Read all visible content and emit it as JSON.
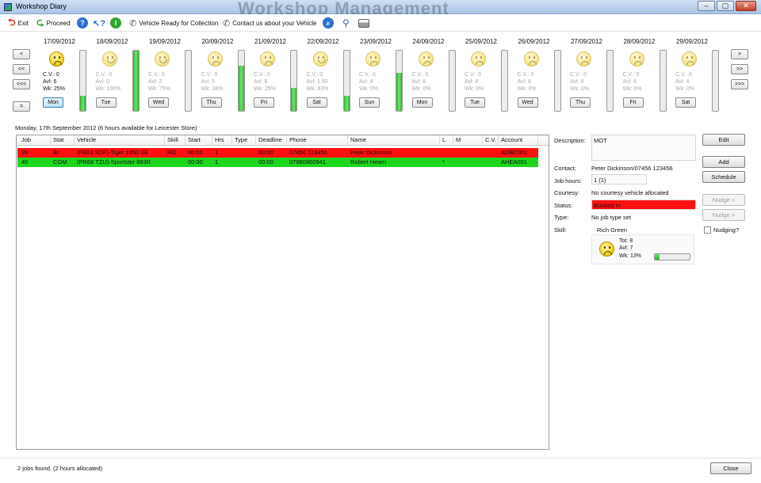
{
  "window": {
    "title": "Workshop Diary",
    "background_heading": "Workshop Management",
    "controls": [
      "–",
      "▢",
      "✕"
    ]
  },
  "toolbar": {
    "exit_label": "Exit",
    "proceed_label": "Proceed",
    "vehicle_ready_label": "Vehicle Ready for Collection",
    "contact_label": "Contact us about your Vehicle"
  },
  "nav": {
    "prev": "<",
    "prev_more": "<<",
    "prev_most": "<<<",
    "next": ">",
    "next_more": ">>",
    "next_most": ">>>",
    "today": "="
  },
  "days": [
    {
      "date": "17/09/2012",
      "day": "Mon",
      "cv": "C.V.: 0",
      "avl": "Avl: 6",
      "wk": "Wk: 25%",
      "fill": 0.25,
      "mood": "sad",
      "current": true
    },
    {
      "date": "18/09/2012",
      "day": "Tue",
      "cv": "C.V.: 0",
      "avl": "Avl: 0",
      "wk": "Wk: 100%",
      "fill": 1.0,
      "mood": "happy",
      "current": false
    },
    {
      "date": "19/09/2012",
      "day": "Wed",
      "cv": "C.V.: 0",
      "avl": "Avl: 2",
      "wk": "Wk: 75%",
      "fill": 0.0,
      "mood": "happy",
      "current": false
    },
    {
      "date": "20/09/2012",
      "day": "Thu",
      "cv": "C.V.: 0",
      "avl": "Avl: 5",
      "wk": "Wk: 38%",
      "fill": 0.75,
      "mood": "sad",
      "current": false
    },
    {
      "date": "21/09/2012",
      "day": "Fri",
      "cv": "C.V.: 0",
      "avl": "Avl: 6",
      "wk": "Wk: 25%",
      "fill": 0.38,
      "mood": "sad",
      "current": false
    },
    {
      "date": "22/09/2012",
      "day": "Sat",
      "cv": "C.V.: 0",
      "avl": "Avl: 1.50",
      "wk": "Wk: 63%",
      "fill": 0.25,
      "mood": "happy",
      "current": false
    },
    {
      "date": "23/09/2012",
      "day": "Sun",
      "cv": "C.V.: 0",
      "avl": "Avl: 4",
      "wk": "Wk: 0%",
      "fill": 0.63,
      "mood": "sad",
      "current": false
    },
    {
      "date": "24/09/2012",
      "day": "Mon",
      "cv": "C.V.: 0",
      "avl": "Avl: 8",
      "wk": "Wk: 0%",
      "fill": 0.0,
      "mood": "sad",
      "current": false
    },
    {
      "date": "25/09/2012",
      "day": "Tue",
      "cv": "C.V.: 0",
      "avl": "Avl: 8",
      "wk": "Wk: 0%",
      "fill": 0.0,
      "mood": "sad",
      "current": false
    },
    {
      "date": "26/09/2012",
      "day": "Wed",
      "cv": "C.V.: 0",
      "avl": "Avl: 8",
      "wk": "Wk: 0%",
      "fill": 0.0,
      "mood": "sad",
      "current": false
    },
    {
      "date": "27/09/2012",
      "day": "Thu",
      "cv": "C.V.: 0",
      "avl": "Avl: 8",
      "wk": "Wk: 0%",
      "fill": 0.0,
      "mood": "sad",
      "current": false
    },
    {
      "date": "28/09/2012",
      "day": "Fri",
      "cv": "C.V.: 0",
      "avl": "Avl: 8",
      "wk": "Wk: 0%",
      "fill": 0.0,
      "mood": "sad",
      "current": false
    },
    {
      "date": "29/09/2012",
      "day": "Sat",
      "cv": "C.V.: 0",
      "avl": "Avl: 4",
      "wk": "Wk: 0%",
      "fill": 0.0,
      "mood": "sad",
      "current": false
    }
  ],
  "summary": "Monday, 17th September 2012 (6 hours available for Leicester Store)",
  "table": {
    "columns": [
      "Job",
      "Stat",
      "Vehicle",
      "Skill",
      "Start",
      "Hrs",
      "Type",
      "Deadline",
      "Phone",
      "Name",
      "L",
      "M",
      "C.V.",
      "Account"
    ],
    "rows": [
      {
        "job": "39",
        "stat": "BI",
        "vehicle": "(FB03 SDF)-Tiger 1050 SE",
        "skill": "RG",
        "start": "00:00",
        "hrs": "1",
        "type": "",
        "deadline": "00:00",
        "phone": "07456 123456",
        "name": "Peter Dickinson",
        "l": "",
        "m": "",
        "cv": "",
        "account": "ADBC001",
        "color": "#ff1010"
      },
      {
        "job": "40",
        "stat": "COM",
        "vehicle": "(PR68 TZU)-Sportster 883R",
        "skill": "",
        "start": "00:00",
        "hrs": "1",
        "type": "",
        "deadline": "00:00",
        "phone": "07980860941",
        "name": "Robert Hearn",
        "l": "*",
        "m": "",
        "cv": "",
        "account": "AHEA001",
        "color": "#1ed61e"
      }
    ]
  },
  "detail": {
    "description_label": "Description:",
    "description": "MOT",
    "contact_label": "Contact:",
    "contact": "Peter Dickinson/07456 123456",
    "job_hours_label": "Job hours:",
    "job_hours": "1 (1)",
    "courtesy_label": "Courtesy:",
    "courtesy": "No courtesy vehicle allocated",
    "status_label": "Status:",
    "status": "Booked In",
    "status_color": "#ff1010",
    "type_label": "Type:",
    "type": "No job type set",
    "skill_label": "Skill:",
    "skill": {
      "name": "Rich Green",
      "tot": "Tot: 8",
      "avl": "Avl: 7",
      "wk": "Wk:  13%",
      "fill": 0.13
    }
  },
  "actions": {
    "edit": "Edit",
    "add": "Add",
    "schedule": "Schedule",
    "nudge_back": "Nudge <",
    "nudge_forward": "Nudge >",
    "nudging": "Nudging?",
    "close": "Close"
  },
  "status_bar": "2 jobs found. (2 hours allocated)"
}
